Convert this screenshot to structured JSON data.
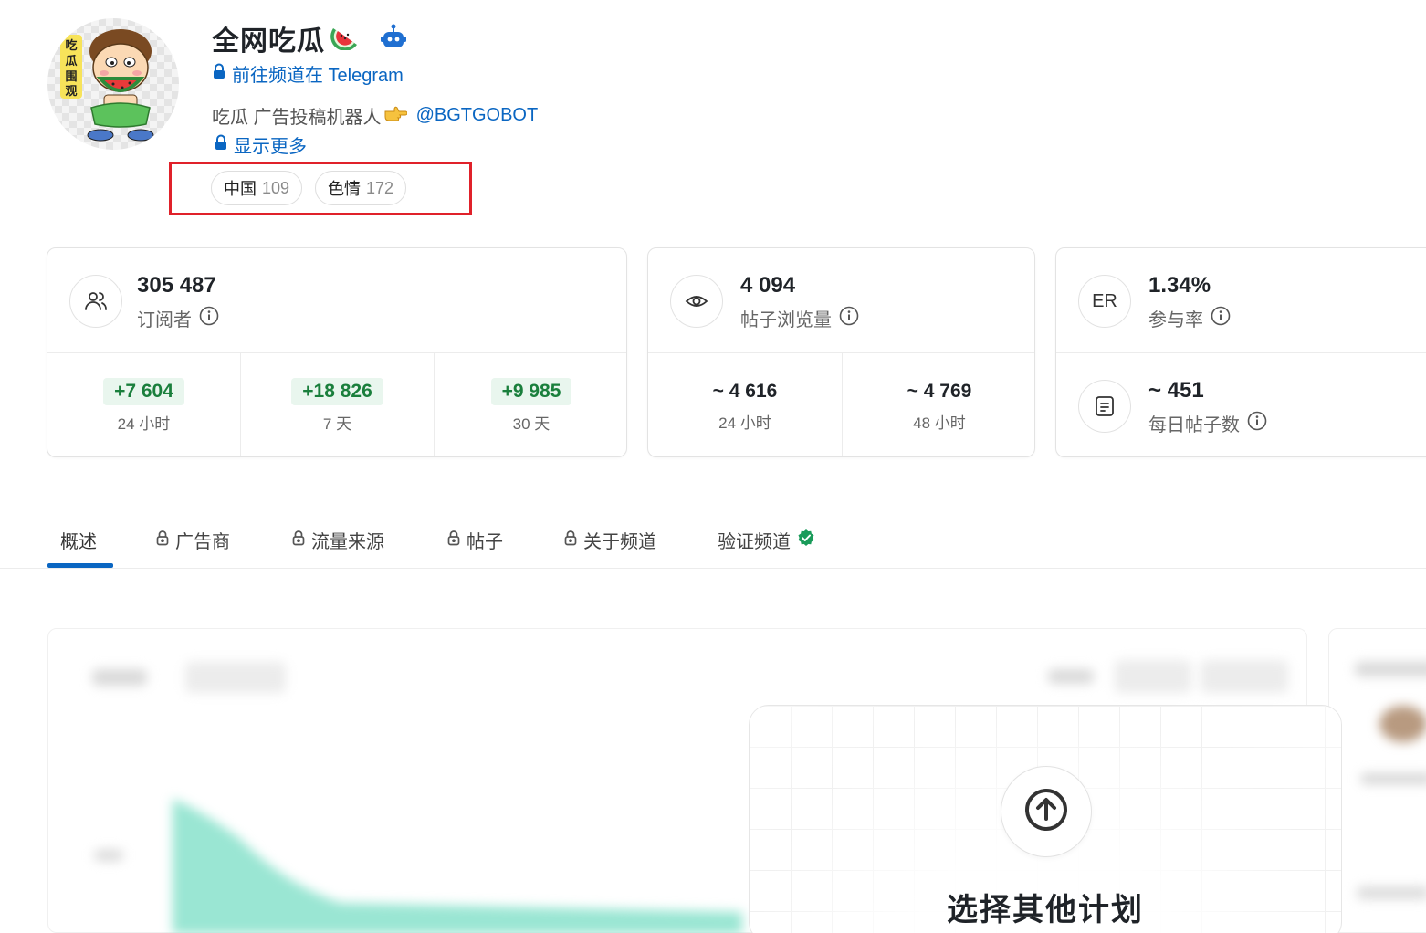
{
  "channel": {
    "name": "全网吃瓜",
    "telegram_link": "前往频道在 Telegram",
    "description": "吃瓜 广告投稿机器人",
    "mention": "@BGTGOBOT",
    "show_more": "显示更多",
    "avatar_text": "吃瓜围观"
  },
  "tags": [
    {
      "label": "中国",
      "count": "109"
    },
    {
      "label": "色情",
      "count": "172"
    }
  ],
  "stats": {
    "subscribers": {
      "value": "305 487",
      "label": "订阅者",
      "deltas": [
        {
          "value": "+7 604",
          "period": "24 小时"
        },
        {
          "value": "+18 826",
          "period": "7 天"
        },
        {
          "value": "+9 985",
          "period": "30 天"
        }
      ]
    },
    "views": {
      "value": "4 094",
      "label": "帖子浏览量",
      "items": [
        {
          "value": "~ 4 616",
          "period": "24 小时"
        },
        {
          "value": "~ 4 769",
          "period": "48 小时"
        }
      ]
    },
    "er": {
      "icon_text": "ER",
      "value": "1.34%",
      "label": "参与率"
    },
    "daily_posts": {
      "value": "~ 451",
      "label": "每日帖子数"
    }
  },
  "tabs": [
    {
      "label": "概述",
      "locked": false,
      "active": true
    },
    {
      "label": "广告商",
      "locked": true
    },
    {
      "label": "流量来源",
      "locked": true
    },
    {
      "label": "帖子",
      "locked": true
    },
    {
      "label": "关于频道",
      "locked": true
    },
    {
      "label": "验证频道",
      "locked": false,
      "verified": true
    }
  ],
  "upgrade": {
    "title": "选择其他计划"
  },
  "colors": {
    "link": "#0a66c2",
    "positive": "#1a7f3c",
    "positive_bg": "#e9f6ee",
    "highlight_box": "#e0212a",
    "verified": "#1a9b5a"
  }
}
